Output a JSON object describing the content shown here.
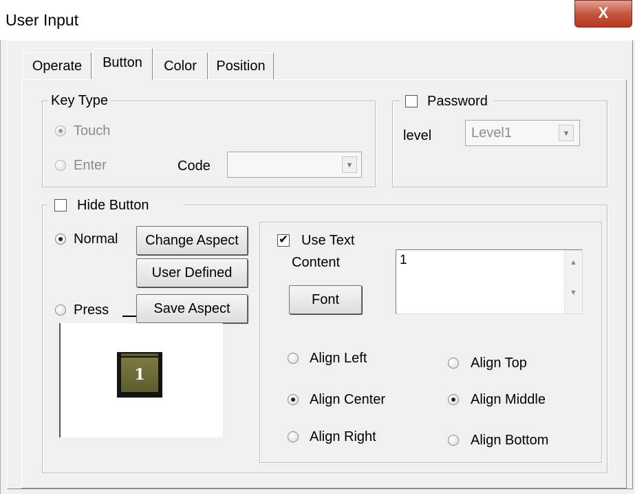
{
  "window": {
    "title": "User Input",
    "close_glyph": "X"
  },
  "tabs": [
    {
      "label": "Operate",
      "active": false
    },
    {
      "label": "Button",
      "active": true
    },
    {
      "label": "Color",
      "active": false
    },
    {
      "label": "Position",
      "active": false
    }
  ],
  "key_type": {
    "legend": "Key Type",
    "touch_label": "Touch",
    "enter_label": "Enter",
    "code_label": "Code",
    "code_value": "",
    "selected": "Touch"
  },
  "password": {
    "label": "Password",
    "checked": false,
    "level_label": "level",
    "level_value": "Level1"
  },
  "hide_button": {
    "label": "Hide Button",
    "checked": false,
    "normal_label": "Normal",
    "press_label": "Press",
    "selected": "Normal",
    "change_aspect": "Change Aspect",
    "user_defined": "User Defined",
    "save_aspect": "Save Aspect",
    "preview_text": "1"
  },
  "text": {
    "use_text_label": "Use Text",
    "use_text_checked": true,
    "content_label": "Content",
    "content_value": "1",
    "font_button": "Font",
    "align_left": "Align Left",
    "align_center": "Align Center",
    "align_right": "Align Right",
    "align_top": "Align Top",
    "align_middle": "Align Middle",
    "align_bottom": "Align Bottom",
    "horizontal_selected": "Align Center",
    "vertical_selected": "Align Middle"
  }
}
